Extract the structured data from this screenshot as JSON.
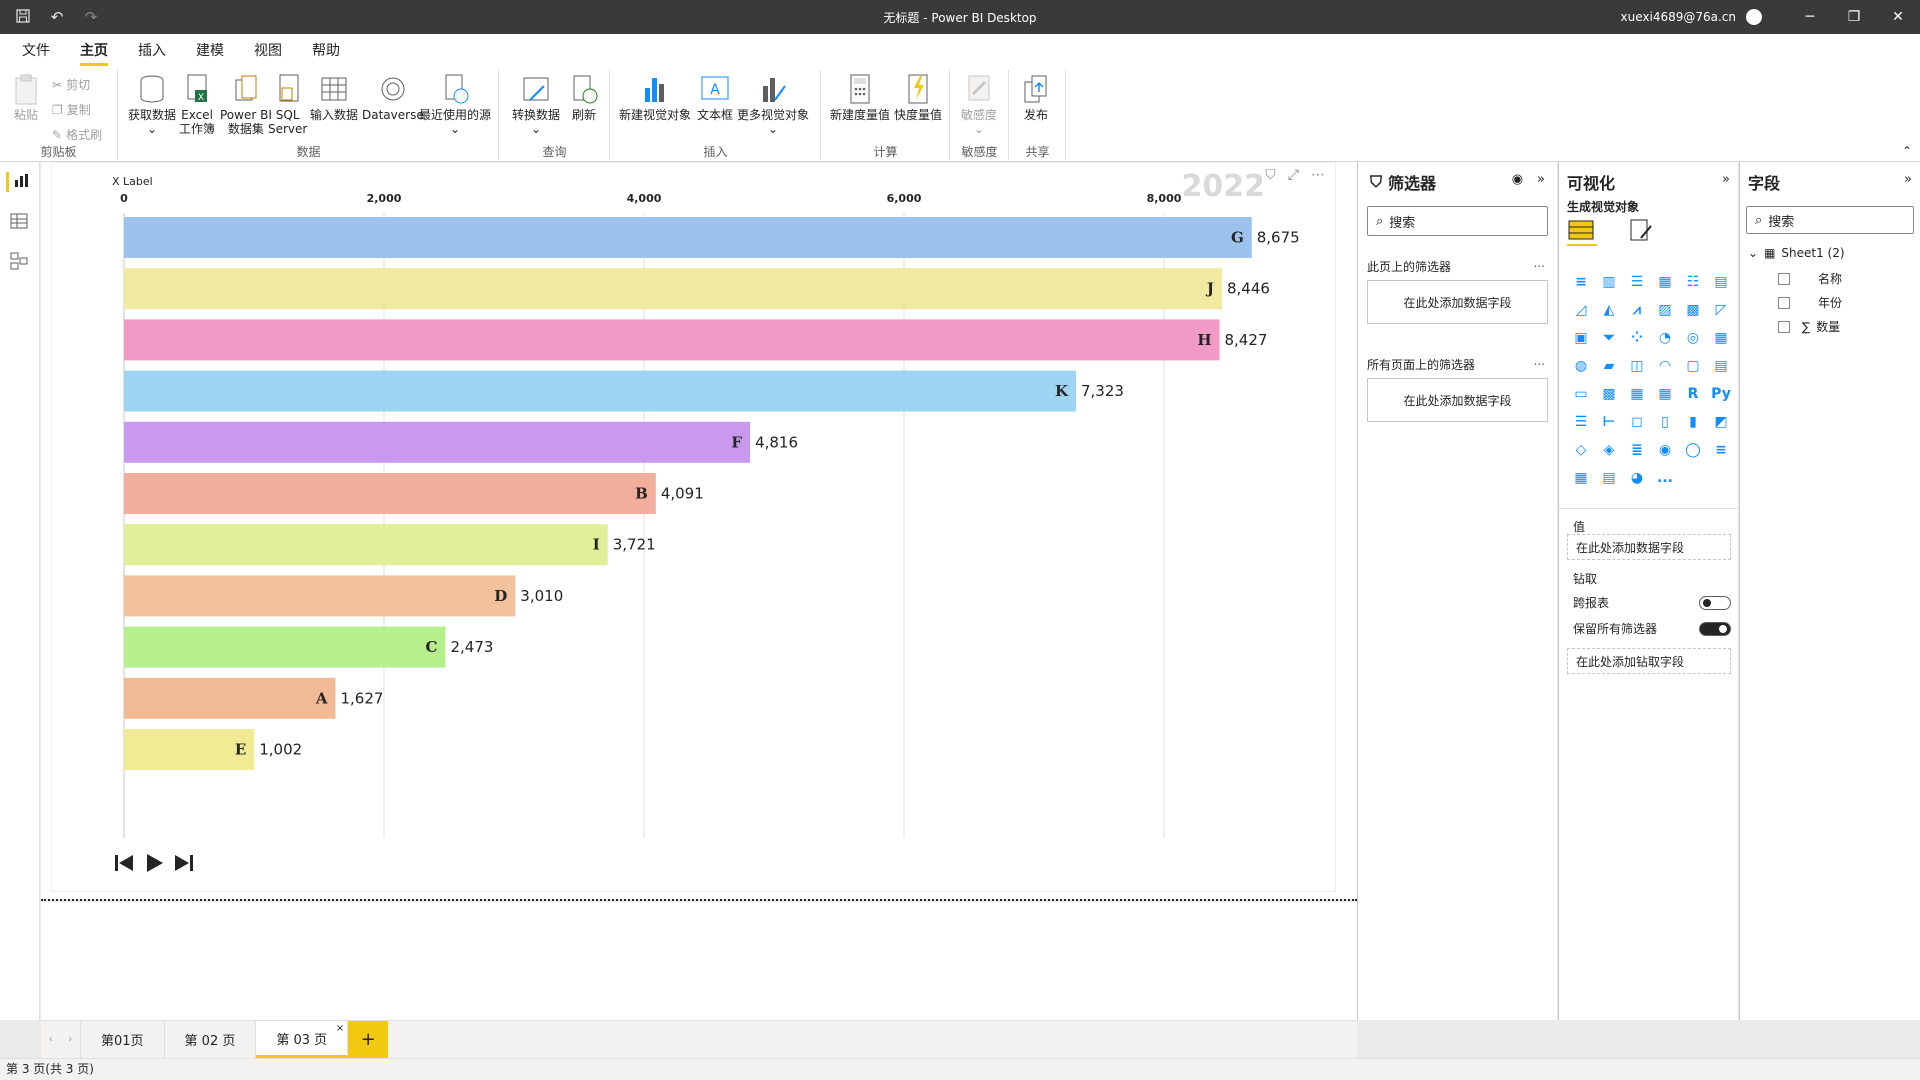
{
  "titlebar": {
    "title": "无标题 - Power BI Desktop",
    "user": "xuexi4689@76a.cn",
    "icons": [
      "save-icon",
      "undo-icon",
      "redo-icon"
    ]
  },
  "menu": {
    "tabs": [
      "文件",
      "主页",
      "插入",
      "建模",
      "视图",
      "帮助"
    ],
    "active": "主页"
  },
  "ribbon": {
    "clipboard": {
      "paste": "粘贴",
      "cut": "剪切",
      "copy": "复制",
      "format_painter": "格式刷",
      "label": "剪贴板"
    },
    "data": {
      "get_data": "获取数据",
      "excel_line1": "Excel",
      "excel_line2": "工作簿",
      "pbi_line1": "Power BI",
      "pbi_line2": "数据集",
      "sql_line1": "SQL",
      "sql_line2": "Server",
      "enter_data": "输入数据",
      "dataverse": "Dataverse",
      "recent": "最近使用的源",
      "label": "数据"
    },
    "query": {
      "transform": "转换数据",
      "refresh": "刷新",
      "label": "查询"
    },
    "insert": {
      "new_visual": "新建视觉对象",
      "textbox": "文本框",
      "more_visuals": "更多视觉对象",
      "label": "插入"
    },
    "calc": {
      "new_measure": "新建度量值",
      "quick_measure": "快度量值",
      "label": "计算"
    },
    "sensitivity": {
      "btn": "敏感度",
      "label": "敏感度"
    },
    "share": {
      "publish": "发布",
      "label": "共享"
    }
  },
  "visual_header": {
    "xlabel": "X Label",
    "year": "2022"
  },
  "chart_data": {
    "type": "bar",
    "orientation": "horizontal",
    "xlabel": "X Label",
    "xlim": [
      0,
      8675
    ],
    "ticks": [
      "0",
      "2,000",
      "4,000",
      "6,000",
      "8,000"
    ],
    "tick_values": [
      0,
      2000,
      4000,
      6000,
      8000
    ],
    "grid": true,
    "categories": [
      "G",
      "J",
      "H",
      "K",
      "F",
      "B",
      "I",
      "D",
      "C",
      "A",
      "E"
    ],
    "values": [
      8675,
      8446,
      8427,
      7323,
      4816,
      4091,
      3721,
      3010,
      2473,
      1627,
      1002
    ],
    "value_labels": [
      "8,675",
      "8,446",
      "8,427",
      "7,323",
      "4,816",
      "4,091",
      "3,721",
      "3,010",
      "2,473",
      "1,627",
      "1,002"
    ],
    "colors": [
      "#9cc3ee",
      "#f2e9a0",
      "#f09ac5",
      "#9dd5f3",
      "#c899ef",
      "#f2ae9c",
      "#dfef9a",
      "#f2c29c",
      "#b6ef8e",
      "#f2bb96",
      "#f2eb96"
    ]
  },
  "page_tabs": {
    "tabs": [
      "第01页",
      "第 02 页",
      "第 03 页"
    ],
    "active_index": 2,
    "add": "+"
  },
  "status": {
    "text": "第 3 页(共 3 页)"
  },
  "filters": {
    "title": "筛选器",
    "search_placeholder": "搜索",
    "this_page": "此页上的筛选器",
    "all_pages": "所有页面上的筛选器",
    "add_field": "在此处添加数据字段",
    "more": "..."
  },
  "visualizations": {
    "title": "可视化",
    "subtitle": "生成视觉对象",
    "values_label": "值",
    "values_well": "在此处添加数据字段",
    "drill_label": "钻取",
    "cross_report": "跨报表",
    "keep_filters": "保留所有筛选器",
    "drill_well": "在此处添加钻取字段",
    "r_label": "R",
    "py_label": "Py",
    "more": "..."
  },
  "fields": {
    "title": "字段",
    "search_placeholder": "搜索",
    "table": "Sheet1 (2)",
    "items": [
      "名称",
      "年份",
      "数量"
    ]
  },
  "accent": "#f2c811"
}
